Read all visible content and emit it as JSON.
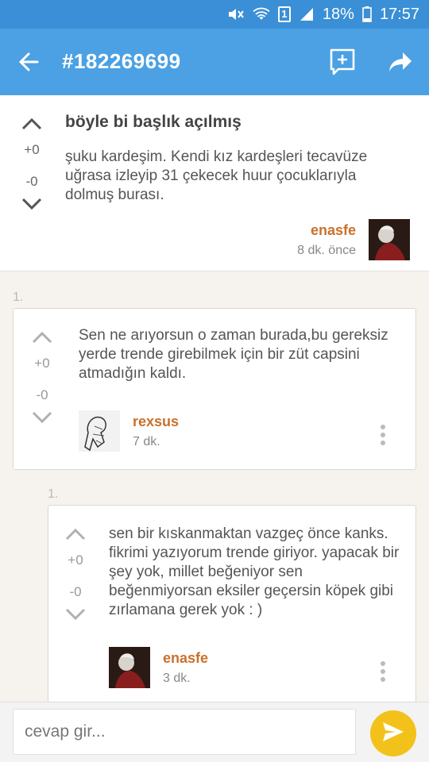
{
  "status_bar": {
    "battery": "18%",
    "time": "17:57",
    "sim": "1"
  },
  "app_bar": {
    "title": "#182269699"
  },
  "post": {
    "title": "böyle bi başlık açılmış",
    "body": "şuku kardeşim. Kendi kız kardeşleri tecavüze uğrasa izleyip 31 çekecek huur çocuklarıyla dolmuş burası.",
    "votes_up": "+0",
    "votes_down": "-0",
    "author": "enasfe",
    "time": "8 dk. önce"
  },
  "replies": [
    {
      "index": "1.",
      "text": "Sen ne arıyorsun o zaman burada,bu gereksiz yerde trende girebilmek için bir züt capsini atmadığın kaldı.",
      "votes_up": "+0",
      "votes_down": "-0",
      "author": "rexsus",
      "time": "7 dk."
    },
    {
      "index": "1.",
      "text": "sen bir kıskanmaktan vazgeç önce kanks. fikrimi yazıyorum trende giriyor. yapacak bir şey yok, millet beğeniyor sen beğenmiyorsan eksiler geçersin köpek gibi zırlamana gerek yok : )",
      "votes_up": "+0",
      "votes_down": "-0",
      "author": "enasfe",
      "time": "3 dk."
    }
  ],
  "compose": {
    "placeholder": "cevap gir..."
  },
  "colors": {
    "status_bar": "#3a8fd6",
    "app_bar": "#4ba1e3",
    "author": "#c9712c",
    "send": "#f2c21a",
    "background": "#f6f3ee"
  },
  "icons": [
    "mute-icon",
    "wifi-icon",
    "sim-icon",
    "signal-icon",
    "battery-icon",
    "back-arrow-icon",
    "add-comment-icon",
    "share-icon",
    "chevron-up-icon",
    "chevron-down-icon",
    "more-vert-icon",
    "send-icon"
  ]
}
